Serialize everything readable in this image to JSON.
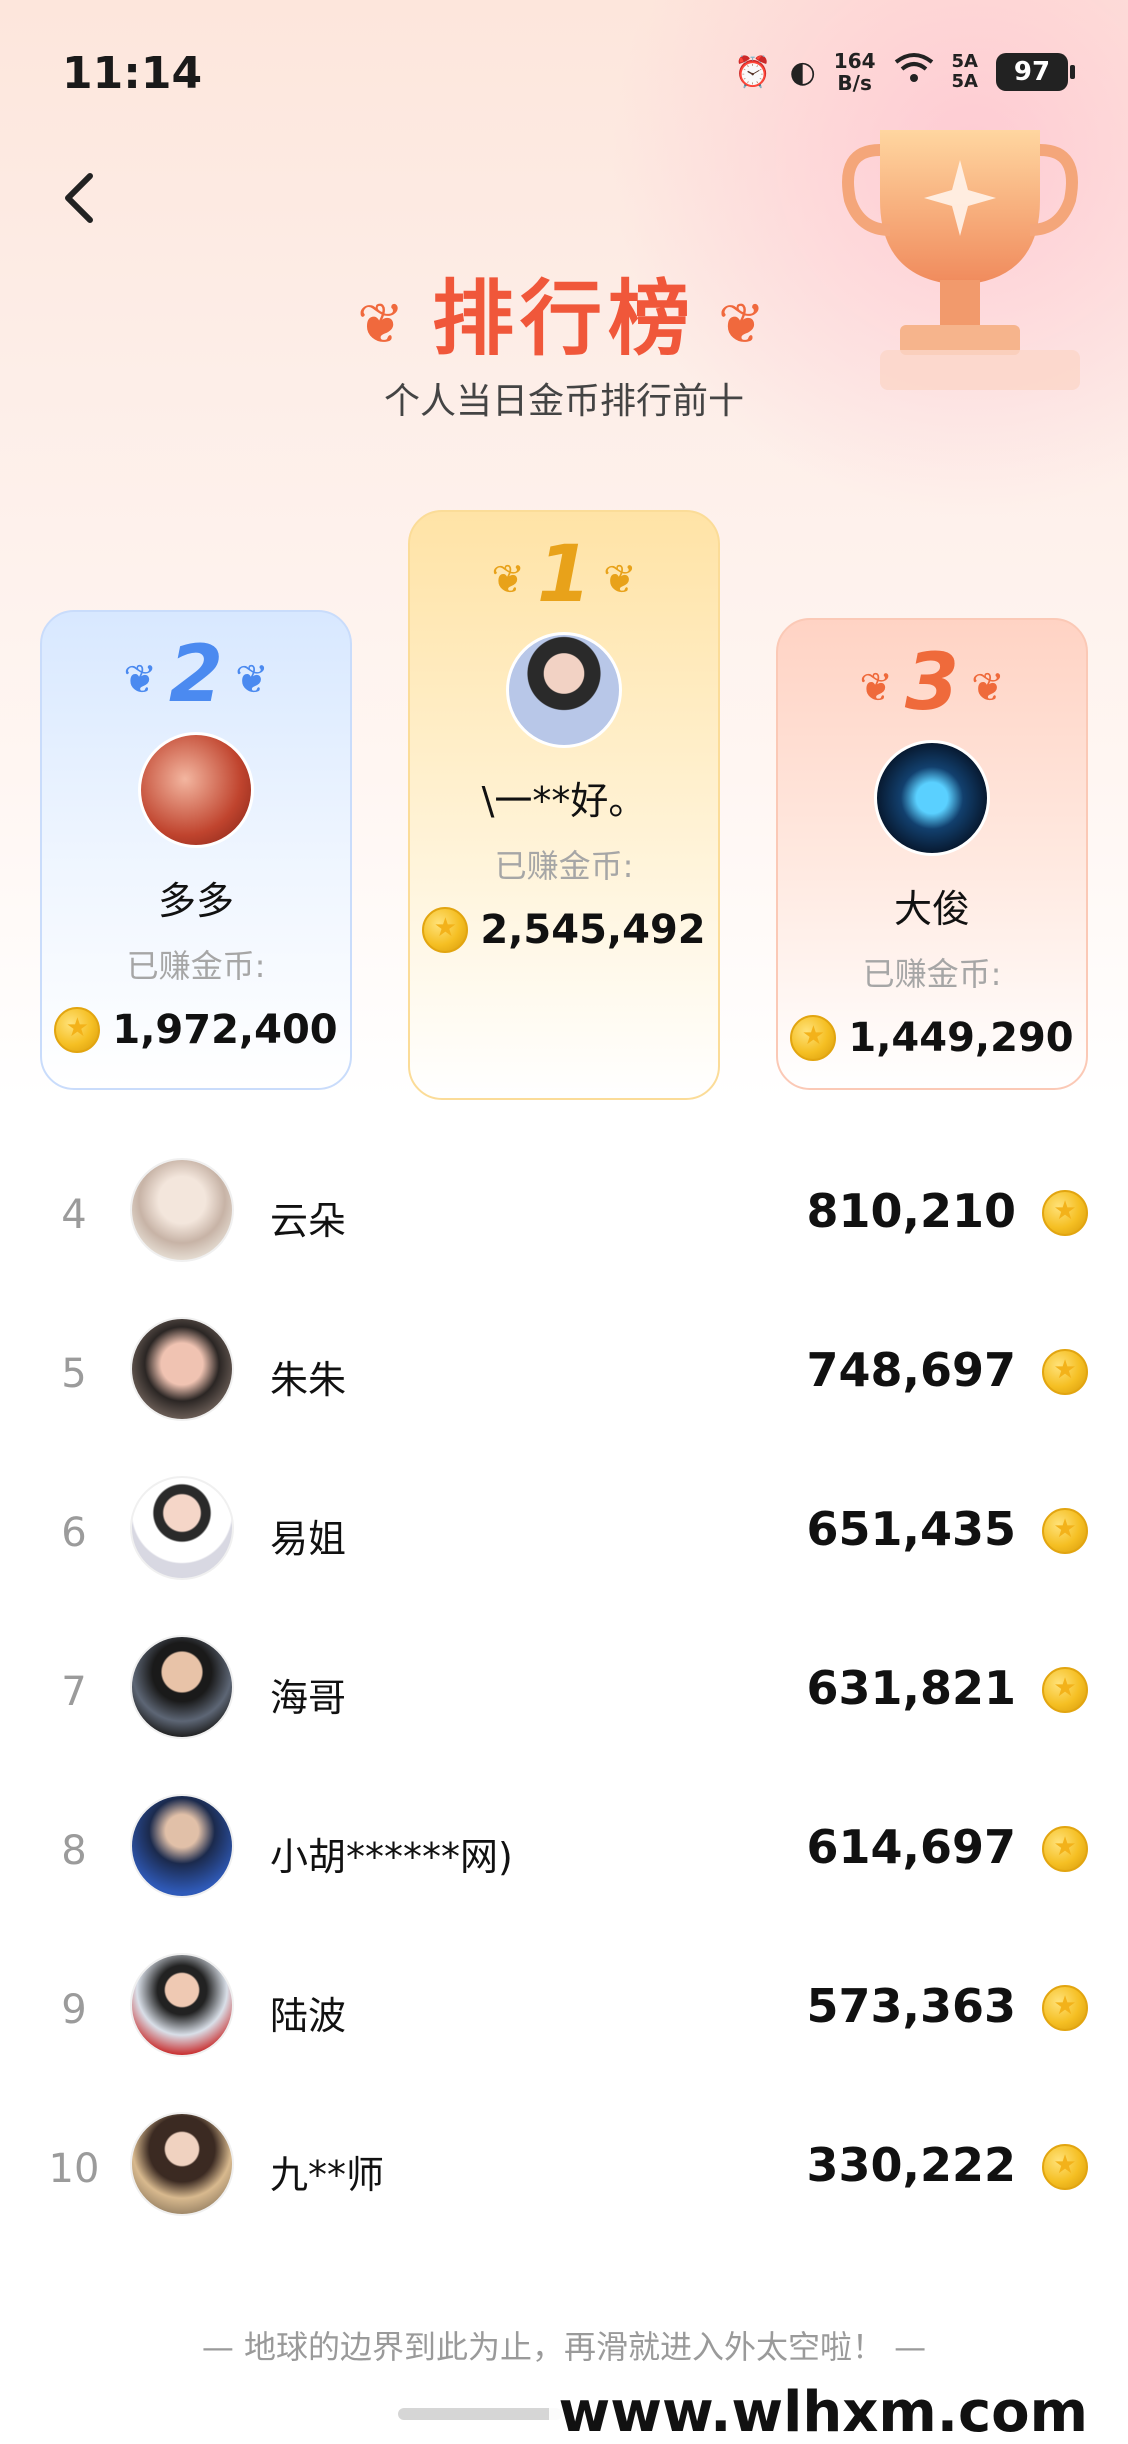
{
  "status_bar": {
    "time": "11:14",
    "net_speed_value": "164",
    "net_speed_unit": "B/s",
    "signal_1": "5A",
    "signal_2": "5A",
    "battery": "97"
  },
  "header": {
    "title": "排行榜",
    "subtitle": "个人当日金币排行前十"
  },
  "podium": [
    {
      "rank": "1",
      "name": "\\一**好。",
      "earned_label": "已赚金币:",
      "amount": "2,545,492"
    },
    {
      "rank": "2",
      "name": "多多",
      "earned_label": "已赚金币:",
      "amount": "1,972,400"
    },
    {
      "rank": "3",
      "name": "大俊",
      "earned_label": "已赚金币:",
      "amount": "1,449,290"
    }
  ],
  "list": [
    {
      "rank": "4",
      "name": "云朵",
      "amount": "810,210"
    },
    {
      "rank": "5",
      "name": "朱朱",
      "amount": "748,697"
    },
    {
      "rank": "6",
      "name": "易姐",
      "amount": "651,435"
    },
    {
      "rank": "7",
      "name": "海哥",
      "amount": "631,821"
    },
    {
      "rank": "8",
      "name": "小胡******网)",
      "amount": "614,697"
    },
    {
      "rank": "9",
      "name": "陆波",
      "amount": "573,363"
    },
    {
      "rank": "10",
      "name": "九**师",
      "amount": "330,222"
    }
  ],
  "footer": {
    "text": "— 地球的边界到此为止，再滑就进入外太空啦！ —",
    "watermark": "www.wlhxm.com"
  },
  "colors": {
    "title_accent": "#f0573a",
    "rank_gold": "#e8a21a",
    "rank_silver": "#4b8af0",
    "rank_bronze": "#ef6a3b",
    "coin": "#f5bf23"
  },
  "icons": [
    "back-arrow-icon",
    "alarm-icon",
    "hd-icon",
    "wifi-icon",
    "battery-icon",
    "trophy-icon",
    "laurel-icon",
    "coin-icon"
  ]
}
